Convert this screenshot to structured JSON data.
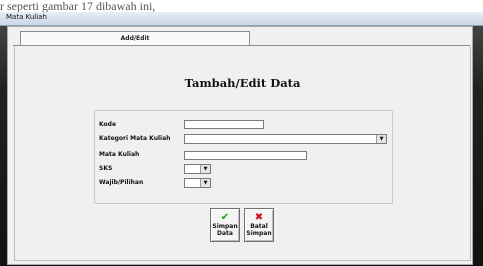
{
  "caption_text": "r seperti gambar 17 dibawah ini,",
  "window": {
    "title": "Mata Kuliah"
  },
  "tabs": [
    {
      "label": "Add/Edit"
    }
  ],
  "form": {
    "heading": "Tambah/Edit Data",
    "fields": {
      "kode": {
        "label": "Kode",
        "value": ""
      },
      "kategori": {
        "label": "Kategori Mata Kuliah",
        "value": ""
      },
      "mata_kuliah": {
        "label": "Mata Kuliah",
        "value": ""
      },
      "sks": {
        "label": "SKS",
        "value": ""
      },
      "wajib": {
        "label": "Wajib/Pilihan",
        "value": ""
      }
    }
  },
  "buttons": {
    "simpan": {
      "line1": "Simpan",
      "line2": "Data",
      "icon": "check-icon",
      "color": "#1a9a1a"
    },
    "batal": {
      "line1": "Batal",
      "line2": "Simpan",
      "icon": "x-icon",
      "color": "#cc1111"
    }
  }
}
